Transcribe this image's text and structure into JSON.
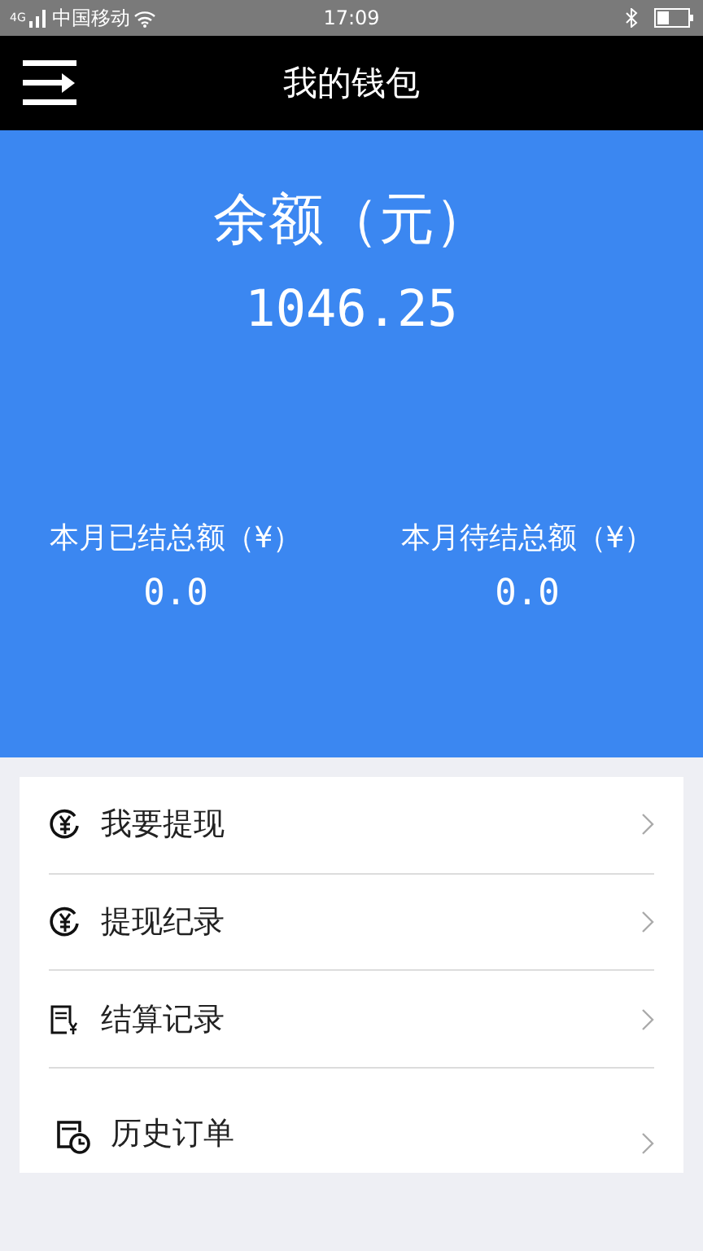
{
  "status_bar": {
    "network": "4G",
    "carrier": "中国移动",
    "time": "17:09"
  },
  "header": {
    "title": "我的钱包"
  },
  "balance": {
    "label": "余额（元）",
    "amount": "1046.25"
  },
  "summary": [
    {
      "label": "本月已结总额（¥）",
      "value": "0.0"
    },
    {
      "label": "本月待结总额（¥）",
      "value": "0.0"
    }
  ],
  "menu": [
    {
      "kind": "coin",
      "label": "我要提现"
    },
    {
      "kind": "coin",
      "label": "提现纪录"
    },
    {
      "kind": "receipt",
      "label": "结算记录"
    },
    {
      "kind": "history",
      "label": "历史订单"
    }
  ]
}
